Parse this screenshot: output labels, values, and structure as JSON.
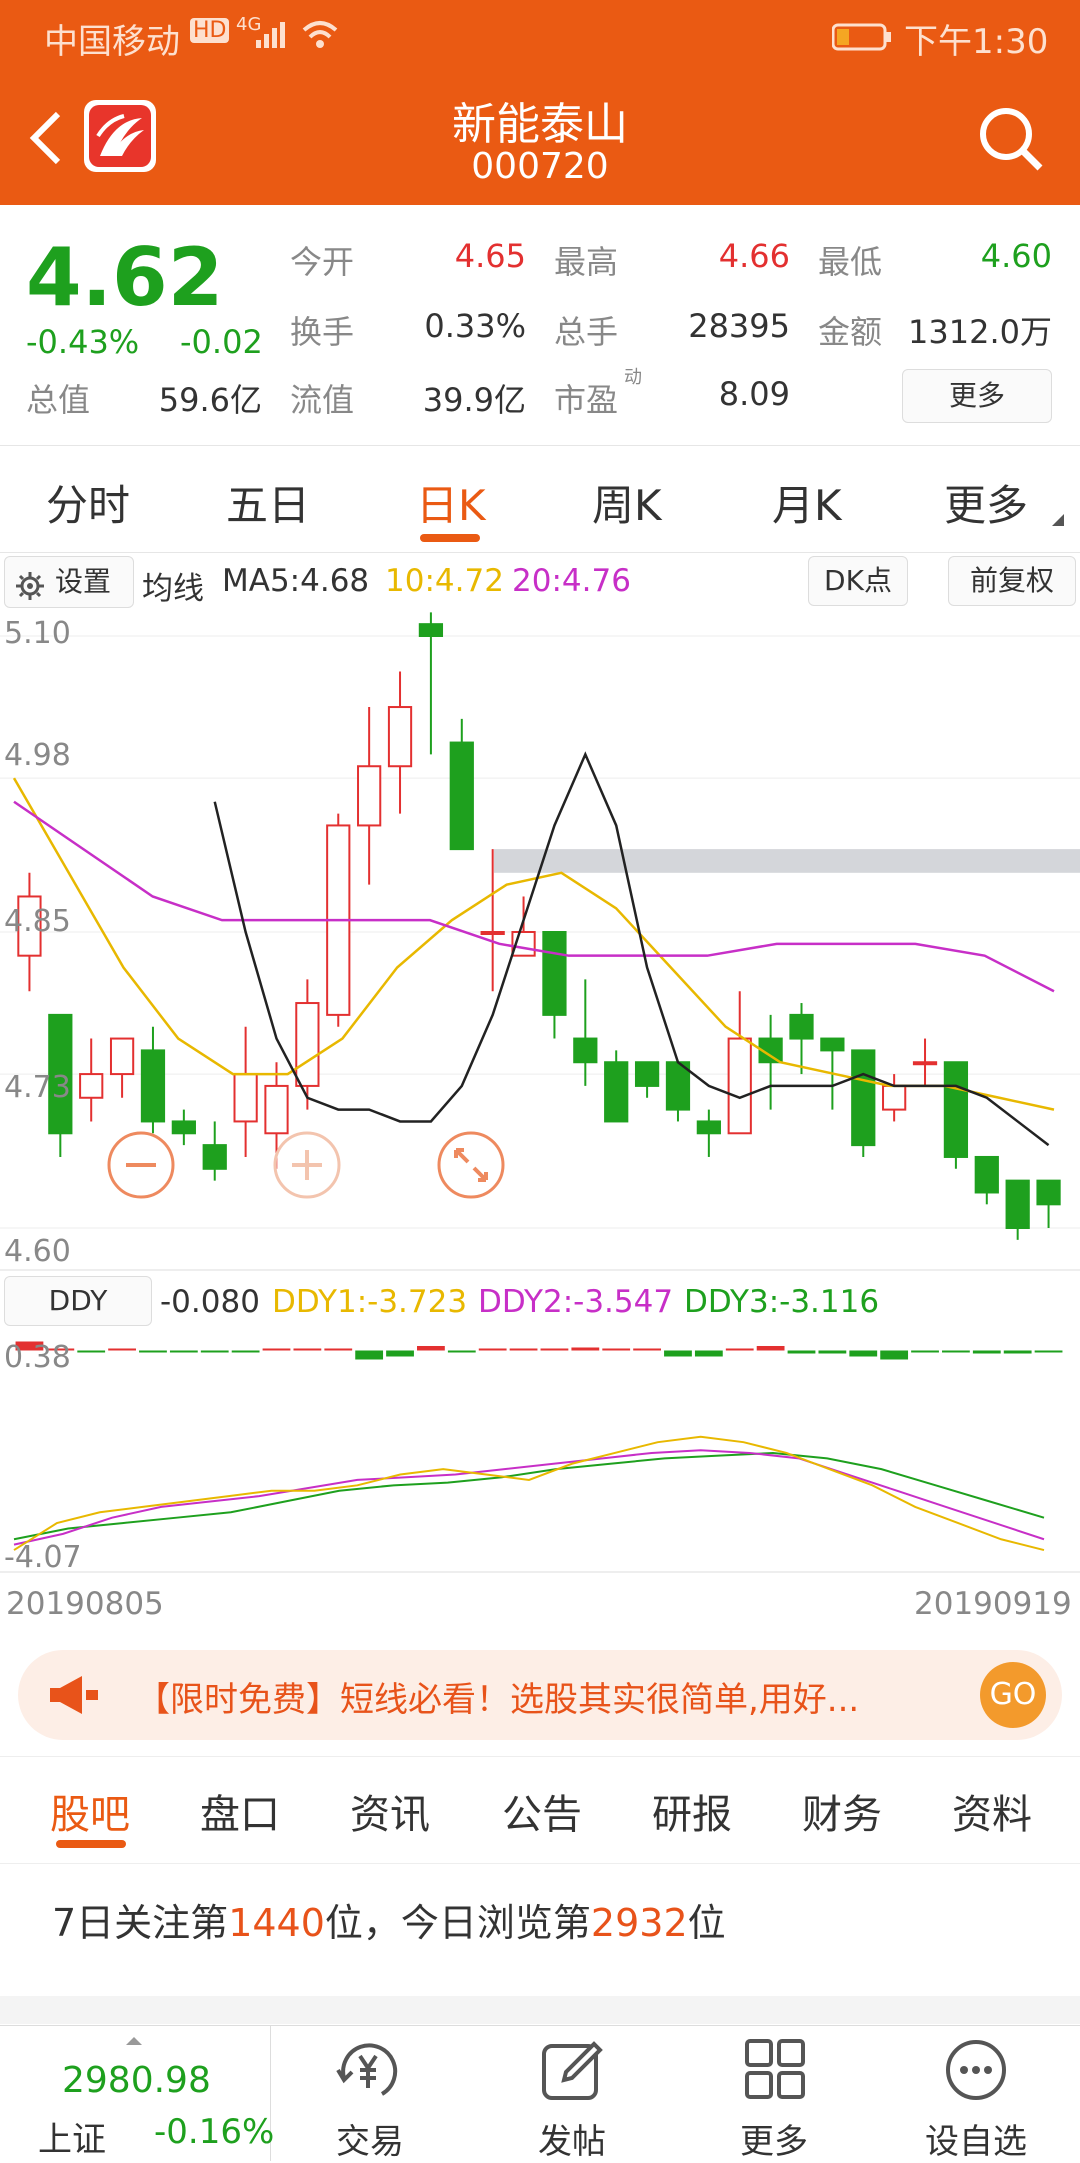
{
  "status": {
    "carrier": "中国移动",
    "hd": "HD",
    "net": "4G",
    "time": "下午1:30"
  },
  "header": {
    "name": "新能泰山",
    "code": "000720"
  },
  "quote": {
    "price": "4.62",
    "pct": "-0.43%",
    "chg": "-0.02",
    "rows": [
      [
        {
          "label": "今开",
          "value": "4.65"
        },
        {
          "label": "最高",
          "value": "4.66"
        },
        {
          "label": "最低",
          "value": "4.60"
        }
      ],
      [
        {
          "label": "换手",
          "value": "0.33%"
        },
        {
          "label": "总手",
          "value": "28395"
        },
        {
          "label": "金额",
          "value": "1312.0万"
        }
      ],
      [
        {
          "label": "流值",
          "value": "39.9亿"
        },
        {
          "label": "市盈",
          "sup": "动",
          "value": "8.09"
        }
      ]
    ],
    "total_label": "总值",
    "total_value": "59.6亿",
    "more": "更多"
  },
  "tabs": [
    "分时",
    "五日",
    "日K",
    "周K",
    "月K",
    "更多"
  ],
  "chart_toolbar": {
    "settings": "设置",
    "ma_label": "均线",
    "ma5": "MA5:4.68",
    "ma10": "10:4.72",
    "ma20": "20:4.76",
    "dk": "DK点",
    "fq": "前复权"
  },
  "chart_data": [
    {
      "type": "candlestick",
      "y_ticks": [
        "5.10",
        "4.98",
        "4.85",
        "4.73",
        "4.60"
      ],
      "ylim": [
        4.6,
        5.1
      ],
      "dates_visible": [
        "20190805",
        "20190919"
      ],
      "candles": [
        [
          4.83,
          4.88,
          4.8,
          4.9
        ],
        [
          4.78,
          4.68,
          4.66,
          4.78
        ],
        [
          4.71,
          4.73,
          4.69,
          4.76
        ],
        [
          4.73,
          4.76,
          4.71,
          4.76
        ],
        [
          4.75,
          4.69,
          4.68,
          4.77
        ],
        [
          4.69,
          4.68,
          4.67,
          4.7
        ],
        [
          4.67,
          4.65,
          4.64,
          4.69
        ],
        [
          4.69,
          4.73,
          4.66,
          4.77
        ],
        [
          4.68,
          4.72,
          4.65,
          4.74
        ],
        [
          4.72,
          4.79,
          4.7,
          4.81
        ],
        [
          4.78,
          4.94,
          4.77,
          4.95
        ],
        [
          4.94,
          4.99,
          4.89,
          5.04
        ],
        [
          4.99,
          5.04,
          4.95,
          5.07
        ],
        [
          5.11,
          5.1,
          5.0,
          5.12
        ],
        [
          5.01,
          4.92,
          4.92,
          5.03
        ],
        [
          4.85,
          4.85,
          4.8,
          4.92
        ],
        [
          4.83,
          4.85,
          4.83,
          4.88
        ],
        [
          4.85,
          4.78,
          4.76,
          4.85
        ],
        [
          4.76,
          4.74,
          4.72,
          4.81
        ],
        [
          4.74,
          4.69,
          4.69,
          4.75
        ],
        [
          4.74,
          4.72,
          4.71,
          4.74
        ],
        [
          4.74,
          4.7,
          4.69,
          4.74
        ],
        [
          4.69,
          4.68,
          4.66,
          4.7
        ],
        [
          4.68,
          4.76,
          4.68,
          4.8
        ],
        [
          4.76,
          4.74,
          4.7,
          4.78
        ],
        [
          4.78,
          4.76,
          4.73,
          4.79
        ],
        [
          4.76,
          4.75,
          4.7,
          4.76
        ],
        [
          4.75,
          4.67,
          4.66,
          4.75
        ],
        [
          4.7,
          4.72,
          4.69,
          4.73
        ],
        [
          4.74,
          4.74,
          4.72,
          4.76
        ],
        [
          4.74,
          4.66,
          4.65,
          4.74
        ],
        [
          4.66,
          4.63,
          4.62,
          4.66
        ],
        [
          4.64,
          4.6,
          4.59,
          4.64
        ],
        [
          4.64,
          4.62,
          4.6,
          4.64
        ]
      ],
      "ma5": [
        4.96,
        4.85,
        4.76,
        4.71,
        4.7,
        4.7,
        4.69,
        4.69,
        4.72,
        4.78,
        4.86,
        4.94,
        5.0,
        4.94,
        4.82,
        4.74,
        4.72,
        4.71,
        4.72,
        4.72,
        4.72,
        4.73,
        4.72,
        4.72,
        4.72,
        4.71,
        4.69,
        4.67
      ],
      "ma10": [
        4.98,
        4.9,
        4.82,
        4.76,
        4.73,
        4.73,
        4.76,
        4.82,
        4.86,
        4.89,
        4.9,
        4.87,
        4.82,
        4.77,
        4.74,
        4.73,
        4.72,
        4.72,
        4.71,
        4.7
      ],
      "ma20": [
        4.96,
        4.92,
        4.88,
        4.86,
        4.86,
        4.86,
        4.86,
        4.84,
        4.83,
        4.83,
        4.83,
        4.84,
        4.84,
        4.84,
        4.83,
        4.8
      ],
      "gap_band": [
        4.9,
        4.92
      ]
    },
    {
      "type": "line",
      "name": "DDY",
      "value": "-0.080",
      "ddy1": "DDY1:-3.723",
      "ddy2": "DDY2:-3.547",
      "ddy3": "DDY3:-3.116",
      "y_ticks": [
        "0.38",
        "-4.07"
      ],
      "ylim": [
        -4.07,
        0.38
      ],
      "bars": [
        0.3,
        0,
        -0.05,
        0,
        -0.05,
        -0.05,
        -0.05,
        -0.05,
        0,
        0.05,
        0.05,
        -0.3,
        -0.2,
        0.15,
        -0.05,
        0.05,
        0,
        0.05,
        0.1,
        0.05,
        0,
        -0.2,
        -0.2,
        0,
        0.15,
        -0.1,
        -0.1,
        -0.2,
        -0.3,
        -0.05,
        -0.05,
        -0.1,
        -0.1,
        -0.05
      ],
      "ddy1_line": [
        -3.7,
        -3.2,
        -3.0,
        -2.9,
        -2.8,
        -2.7,
        -2.6,
        -2.6,
        -2.5,
        -2.3,
        -2.2,
        -2.3,
        -2.4,
        -2.1,
        -1.9,
        -1.7,
        -1.6,
        -1.7,
        -1.9,
        -2.2,
        -2.5,
        -2.9,
        -3.2,
        -3.5,
        -3.7
      ],
      "ddy2_line": [
        -3.6,
        -3.4,
        -3.1,
        -2.9,
        -2.8,
        -2.7,
        -2.55,
        -2.4,
        -2.35,
        -2.3,
        -2.2,
        -2.1,
        -2.0,
        -1.9,
        -1.85,
        -1.9,
        -2.0,
        -2.3,
        -2.6,
        -2.9,
        -3.2,
        -3.5
      ],
      "ddy3_line": [
        -3.5,
        -3.3,
        -3.2,
        -3.1,
        -3.0,
        -2.8,
        -2.6,
        -2.5,
        -2.45,
        -2.35,
        -2.2,
        -2.1,
        -2.0,
        -1.95,
        -1.9,
        -2.0,
        -2.2,
        -2.5,
        -2.8,
        -3.1
      ]
    }
  ],
  "ad": {
    "text": "【限时免费】短线必看！选股其实很简单,用好...",
    "go": "GO"
  },
  "subtabs": [
    "股吧",
    "盘口",
    "资讯",
    "公告",
    "研报",
    "财务",
    "资料"
  ],
  "rank": {
    "p1": "7日关注第",
    "n1": "1440",
    "p2": "位，今日浏览第",
    "n2": "2932",
    "p3": "位"
  },
  "index": {
    "value": "2980.98",
    "name": "上证",
    "pct": "-0.16%"
  },
  "nav": [
    "交易",
    "发帖",
    "更多",
    "设自选"
  ],
  "colors": {
    "brand": "#ea5a13",
    "up": "#e33030",
    "down": "#1ea01e",
    "ma10": "#e8b800",
    "ma20": "#c72fc7"
  }
}
